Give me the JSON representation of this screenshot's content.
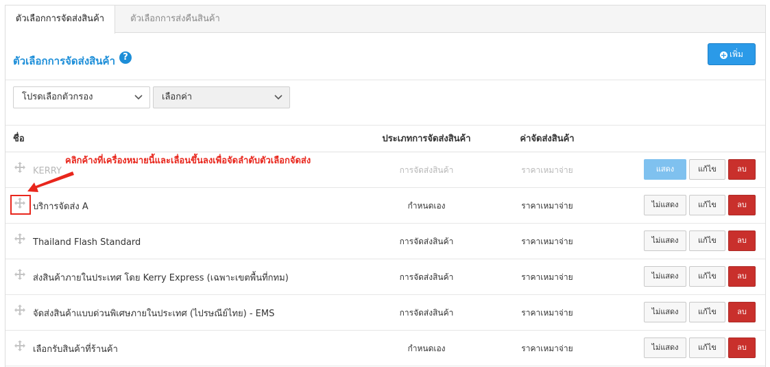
{
  "tabs": [
    {
      "label": "ตัวเลือกการจัดส่งสินค้า",
      "active": true
    },
    {
      "label": "ตัวเลือกการส่งคืนสินค้า",
      "active": false
    }
  ],
  "header": {
    "title": "ตัวเลือกการจัดส่งสินค้า",
    "help_icon": "question-circle-icon",
    "add_label": "เพิ่ม",
    "add_icon": "plus-circle-icon"
  },
  "filters": {
    "filter_select": "โปรดเลือกตัวกรอง",
    "value_select": "เลือกค่า"
  },
  "columns": {
    "name": "ชื่อ",
    "type": "ประเภทการจัดส่งสินค้า",
    "cost": "ค่าจัดส่งสินค้า"
  },
  "annotation": {
    "text": "คลิกค้างที่เครื่องหมายนี้และเลื่อนขึ้นลงเพื่อจัดลำดับตัวเลือกจัดส่ง",
    "color": "#e8261c"
  },
  "rows": [
    {
      "name": "KERRY",
      "type": "การจัดส่งสินค้า",
      "cost": "ราคาเหมาจ่าย",
      "toggle": "แสดง",
      "edit": "แก้ไข",
      "delete": "ลบ",
      "hidden": true
    },
    {
      "name": "บริการจัดส่ง A",
      "type": "กำหนดเอง",
      "cost": "ราคาเหมาจ่าย",
      "toggle": "ไม่แสดง",
      "edit": "แก้ไข",
      "delete": "ลบ",
      "hidden": false
    },
    {
      "name": "Thailand Flash Standard",
      "type": "การจัดส่งสินค้า",
      "cost": "ราคาเหมาจ่าย",
      "toggle": "ไม่แสดง",
      "edit": "แก้ไข",
      "delete": "ลบ",
      "hidden": false
    },
    {
      "name": "ส่งสินค้าภายในประเทศ โดย Kerry Express (เฉพาะเขตพื้นที่กทม)",
      "type": "การจัดส่งสินค้า",
      "cost": "ราคาเหมาจ่าย",
      "toggle": "ไม่แสดง",
      "edit": "แก้ไข",
      "delete": "ลบ",
      "hidden": false
    },
    {
      "name": "จัดส่งสินค้าแบบด่วนพิเศษภายในประเทศ (ไปรษณีย์ไทย) - EMS",
      "type": "การจัดส่งสินค้า",
      "cost": "ราคาเหมาจ่าย",
      "toggle": "ไม่แสดง",
      "edit": "แก้ไข",
      "delete": "ลบ",
      "hidden": false
    },
    {
      "name": "เลือกรับสินค้าที่ร้านค้า",
      "type": "กำหนดเอง",
      "cost": "ราคาเหมาจ่าย",
      "toggle": "ไม่แสดง",
      "edit": "แก้ไข",
      "delete": "ลบ",
      "hidden": false
    }
  ]
}
